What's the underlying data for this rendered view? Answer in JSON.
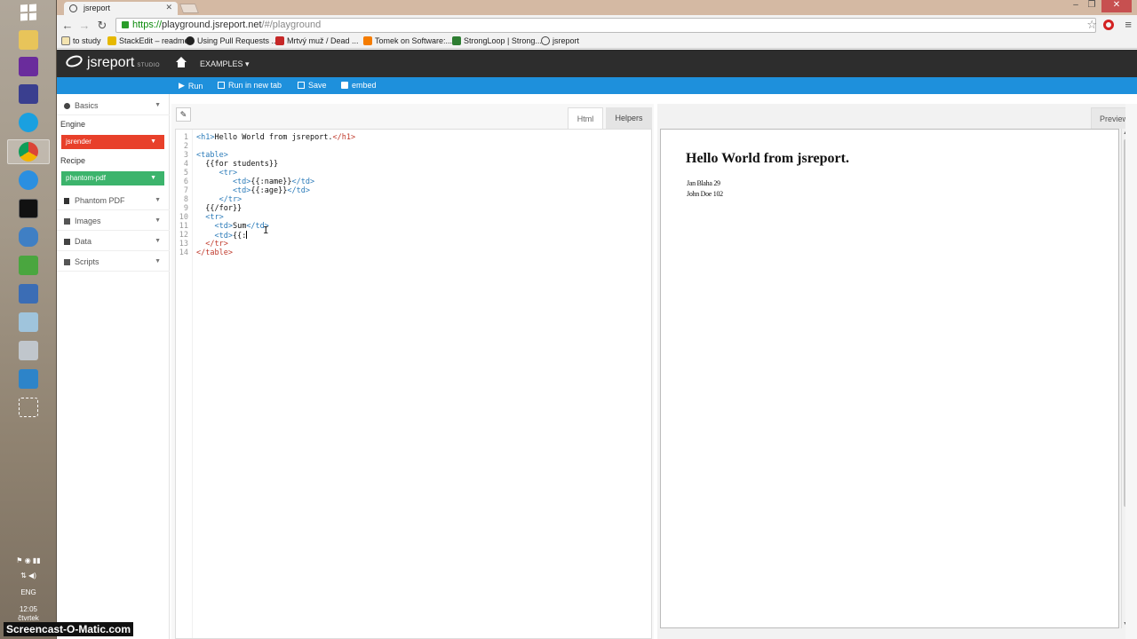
{
  "taskbar": {
    "apps": [
      "file-manager",
      "visual-studio",
      "save-disk",
      "skype",
      "chrome",
      "internet-explorer",
      "terminal",
      "database",
      "home-app",
      "remote-desktop",
      "notepad",
      "network",
      "document",
      "selection-tool"
    ],
    "tray_lang": "ENG",
    "tray_time": "12:05",
    "tray_day": "čtvrtek"
  },
  "browser": {
    "tab_title": "jsreport",
    "url_https": "https://",
    "url_host": "playground.jsreport.net",
    "url_path": "/#/playground",
    "bookmarks": [
      "to study",
      "StackEdit – readme",
      "Using Pull Requests ...",
      "Mrtvý muž / Dead ...",
      "Tomek on Software:...",
      "StrongLoop | Strong...",
      "jsreport"
    ]
  },
  "app": {
    "logo_name": "jsreport",
    "logo_sub": "STUDIO",
    "examples_label": "EXAMPLES ▾",
    "actions": {
      "run": "Run",
      "run_new_tab": "Run in new tab",
      "save": "Save",
      "embed": "embed"
    }
  },
  "sidebar": {
    "basics": "Basics",
    "engine_label": "Engine",
    "engine_value": "jsrender",
    "recipe_label": "Recipe",
    "recipe_value": "phantom-pdf",
    "sections": [
      "Phantom PDF",
      "Images",
      "Data",
      "Scripts"
    ]
  },
  "editor": {
    "tabs": [
      "Html",
      "Helpers"
    ],
    "lines": [
      {
        "n": "1",
        "parts": [
          [
            "tag",
            "<h1>"
          ],
          [
            "txt",
            "Hello World from jsreport."
          ],
          [
            "tagr",
            "</h1>"
          ]
        ]
      },
      {
        "n": "2",
        "parts": []
      },
      {
        "n": "3",
        "parts": [
          [
            "tag",
            "<table>"
          ]
        ]
      },
      {
        "n": "4",
        "parts": [
          [
            "txt",
            "  {{for students}}"
          ]
        ]
      },
      {
        "n": "5",
        "parts": [
          [
            "tag",
            "     <tr>"
          ]
        ]
      },
      {
        "n": "6",
        "parts": [
          [
            "tag",
            "        <td>"
          ],
          [
            "txt",
            "{{:name}}"
          ],
          [
            "tag",
            "</td>"
          ]
        ]
      },
      {
        "n": "7",
        "parts": [
          [
            "tag",
            "        <td>"
          ],
          [
            "txt",
            "{{:age}}"
          ],
          [
            "tag",
            "</td>"
          ]
        ]
      },
      {
        "n": "8",
        "parts": [
          [
            "tag",
            "     </tr>"
          ]
        ]
      },
      {
        "n": "9",
        "parts": [
          [
            "txt",
            "  {{/for}}"
          ]
        ]
      },
      {
        "n": "10",
        "parts": [
          [
            "tag",
            "  <tr>"
          ]
        ]
      },
      {
        "n": "11",
        "parts": [
          [
            "tag",
            "    <td>"
          ],
          [
            "txt",
            "Sum"
          ],
          [
            "tag",
            "</td>"
          ]
        ]
      },
      {
        "n": "12",
        "parts": [
          [
            "tag",
            "    <td>"
          ],
          [
            "txt",
            "{{:"
          ]
        ]
      },
      {
        "n": "13",
        "parts": [
          [
            "tagr",
            "  </tr>"
          ]
        ]
      },
      {
        "n": "14",
        "parts": [
          [
            "tagr",
            "</table>"
          ]
        ]
      }
    ]
  },
  "preview": {
    "tab": "Preview",
    "heading": "Hello World from jsreport.",
    "rows": [
      "Jan Blaha 29",
      "John Doe 102"
    ]
  },
  "watermark": "Screencast-O-Matic.com",
  "colors": {
    "accent_blue": "#1e90dc",
    "engine_red": "#e8402a",
    "recipe_green": "#3cb46c",
    "header_dark": "#2d2d2d"
  }
}
